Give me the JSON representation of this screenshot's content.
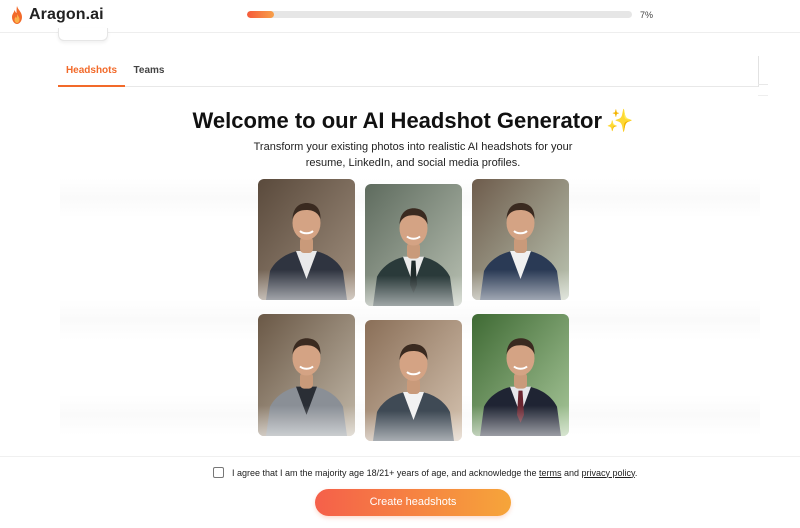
{
  "header": {
    "brand": "Aragon.ai",
    "progress_label": "7%",
    "progress_value": 0.07,
    "progress_color": "#f65a3a"
  },
  "tabs": [
    {
      "label": "Headshots",
      "active": true
    },
    {
      "label": "Teams",
      "active": false
    }
  ],
  "hero": {
    "title": "Welcome to our AI Headshot Generator",
    "sparkle_icon": "✨",
    "subtitle_line1": "Transform your existing photos into realistic AI headshots for your",
    "subtitle_line2": "resume, LinkedIn, and social media profiles."
  },
  "gallery": [
    {
      "name": "headshot-1",
      "icon": "man-portrait"
    },
    {
      "name": "headshot-2",
      "icon": "man-portrait"
    },
    {
      "name": "headshot-3",
      "icon": "man-portrait"
    },
    {
      "name": "headshot-4",
      "icon": "man-portrait"
    },
    {
      "name": "headshot-5",
      "icon": "man-portrait"
    },
    {
      "name": "headshot-6",
      "icon": "man-portrait"
    }
  ],
  "consent": {
    "text_before": "I agree that I am the majority age 18/21+ years of age, and acknowledge the ",
    "terms_link": "terms",
    "text_middle": " and ",
    "privacy_link": "privacy policy",
    "text_after": "."
  },
  "cta": {
    "label": "Create headshots",
    "accent": "#f5604a"
  }
}
